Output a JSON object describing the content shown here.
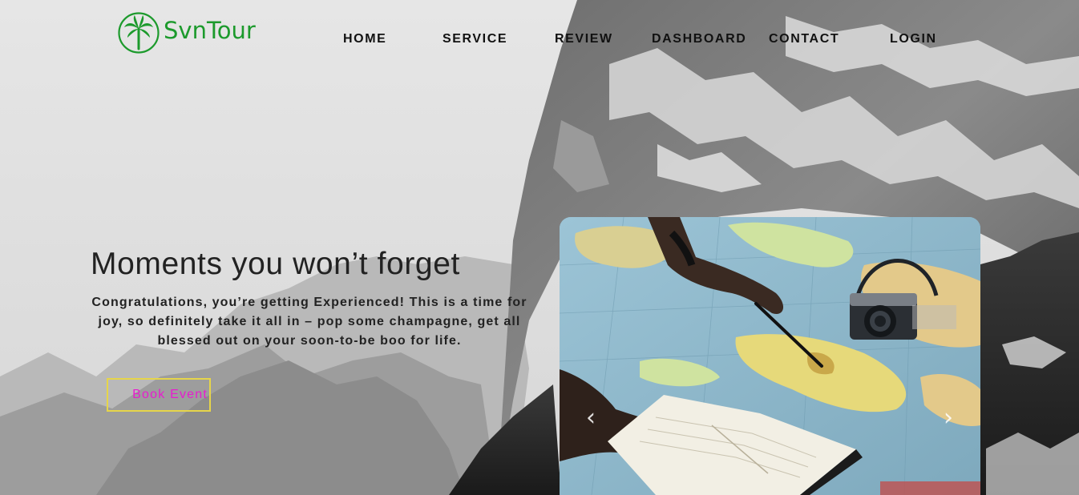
{
  "brand": {
    "name": "SvnTour",
    "logo_icon": "palm-tree-icon",
    "color": "#1c9a2c"
  },
  "nav": {
    "items": [
      {
        "label": "HOME"
      },
      {
        "label": "SERVICE"
      },
      {
        "label": "REVIEW"
      },
      {
        "label": "DASHBOARD"
      },
      {
        "label": "CONTACT"
      },
      {
        "label": "LOGIN"
      }
    ]
  },
  "hero": {
    "headline": "Moments you won’t forget",
    "blurb": "Congratulations, you’re getting Experienced! This is a time for joy, so definitely take it all in – pop some champagne, get all blessed out on your soon-to-be boo for life.",
    "cta_label": "Book Event",
    "cta_text_color": "#e81ccf",
    "cta_border_color": "#e6d54a"
  },
  "carousel": {
    "prev_icon": "chevron-left-icon",
    "next_icon": "chevron-right-icon",
    "prev_glyph": "‹",
    "next_glyph": "›",
    "slide_subject": "map-camera-notebook-photo"
  }
}
